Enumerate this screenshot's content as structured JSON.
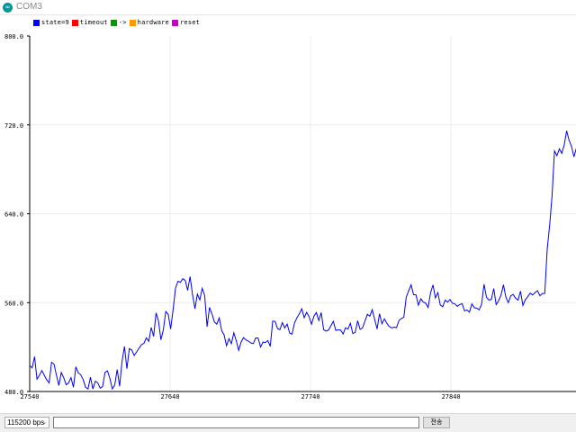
{
  "window": {
    "title": "COM3",
    "icon": "arduino-icon"
  },
  "legend": [
    {
      "label": "state=9",
      "color": "#0000ff"
    },
    {
      "label": "timeout",
      "color": "#ff0000"
    },
    {
      "label": "->",
      "color": "#009900"
    },
    {
      "label": "hardware",
      "color": "#ff9900"
    },
    {
      "label": "reset",
      "color": "#cc00cc"
    }
  ],
  "controls": {
    "baud_rate": "115200 bps",
    "send_value": "",
    "send_label": "전송"
  },
  "chart_data": {
    "type": "line",
    "ylim": [
      500.0,
      800.0
    ],
    "xlim": [
      27540,
      27929
    ],
    "y_ticks": [
      "800.0",
      "720.0",
      "640.0",
      "560.0",
      "480.0"
    ],
    "x_ticks": [
      "27540",
      "27640",
      "27740",
      "27840"
    ],
    "grid": true,
    "series": [
      {
        "color": "#0000ff",
        "y": [
          521.9,
          519.9,
          529.4,
          510.4,
          513.7,
          517.7,
          513.7,
          509.8,
          507.3,
          524.7,
          523.2,
          513.8,
          505.0,
          516.0,
          511.6,
          505.7,
          507.3,
          511.7,
          503.6,
          520.8,
          515.7,
          514.1,
          510.0,
          503.6,
          502.1,
          512.1,
          502.1,
          508.7,
          507.4,
          502.8,
          504.1,
          516.1,
          517.5,
          511.0,
          502.2,
          505.5,
          518.5,
          504.4,
          525.3,
          538.0,
          519.2,
          536.2,
          535.0,
          530.4,
          533.4,
          536.5,
          539.5,
          540.6,
          545.3,
          542.4,
          554.0,
          546.5,
          566.3,
          559.5,
          543.7,
          552.1,
          567.5,
          565.0,
          552.7,
          568.7,
          587.0,
          593.1,
          592.1,
          595.2,
          593.9,
          585.4,
          597.0,
          581.9,
          569.9,
          582.2,
          577.3,
          587.0,
          581.0,
          554.7,
          570.9,
          565.6,
          558.7,
          556.8,
          562.1,
          551.4,
          547.8,
          538.6,
          544.6,
          540.3,
          549.6,
          542.8,
          534.8,
          541.7,
          545.5,
          543.5,
          542.5,
          541.0,
          540.4,
          545.2,
          545.1,
          537.5,
          541.6,
          541.4,
          542.9,
          538.1,
          559.4,
          559.1,
          553.2,
          552.2,
          558.1,
          553.7,
          556.9,
          549.4,
          548.4,
          557.8,
          562.2,
          565.5,
          569.8,
          562.3,
          566.8,
          563.1,
          556.8,
          563.5,
          566.6,
          559.9,
          566.6,
          552.2,
          551.0,
          551.8,
          555.5,
          559.2,
          551.6,
          552.0,
          551.9,
          548.5,
          553.8,
          552.6,
          557.6,
          548.9,
          549.8,
          559.8,
          552.4,
          553.7,
          559.4,
          565.2,
          563.6,
          569.0,
          560.8,
          552.7,
          565.6,
          557.2,
          561.3,
          557.6,
          554.8,
          553.7,
          554.3,
          553.9,
          560.0,
          561.6,
          562.7,
          579.7,
          585.0,
          590.0,
          581.7,
          581.6,
          572.8,
          578.3,
          575.4,
          574.6,
          570.9,
          583.4,
          589.9,
          579.0,
          583.5,
          573.1,
          571.5,
          577.1,
          575.4,
          577.6,
          574.4,
          573.9,
          571.9,
          573.4,
          574.1,
          568.0,
          568.8,
          567.0,
          573.9,
          570.7,
          570.3,
          568.9,
          573.6,
          590.5,
          579.6,
          577.2,
          577.6,
          586.9,
          573.3,
          576.6,
          581.4,
          590.1,
          579.6,
          575.0,
          580.7,
          581.9,
          578.7,
          577.1,
          584.7,
          572.6,
          577.5,
          580.0,
          583.0,
          581.5,
          583.3,
          585.1,
          580.8,
          582.7,
          582.8,
          620.1,
          640.0,
          665.0,
          703.0,
          699.0,
          704.8,
          701.0,
          708.0,
          720.0,
          712.0,
          707.0,
          698.0,
          705.4,
          693.3,
          697.0,
          699.9,
          706.0,
          705.7,
          698.6,
          703.7,
          704.9,
          698.4
        ],
        "x_step": 1.73
      }
    ]
  }
}
